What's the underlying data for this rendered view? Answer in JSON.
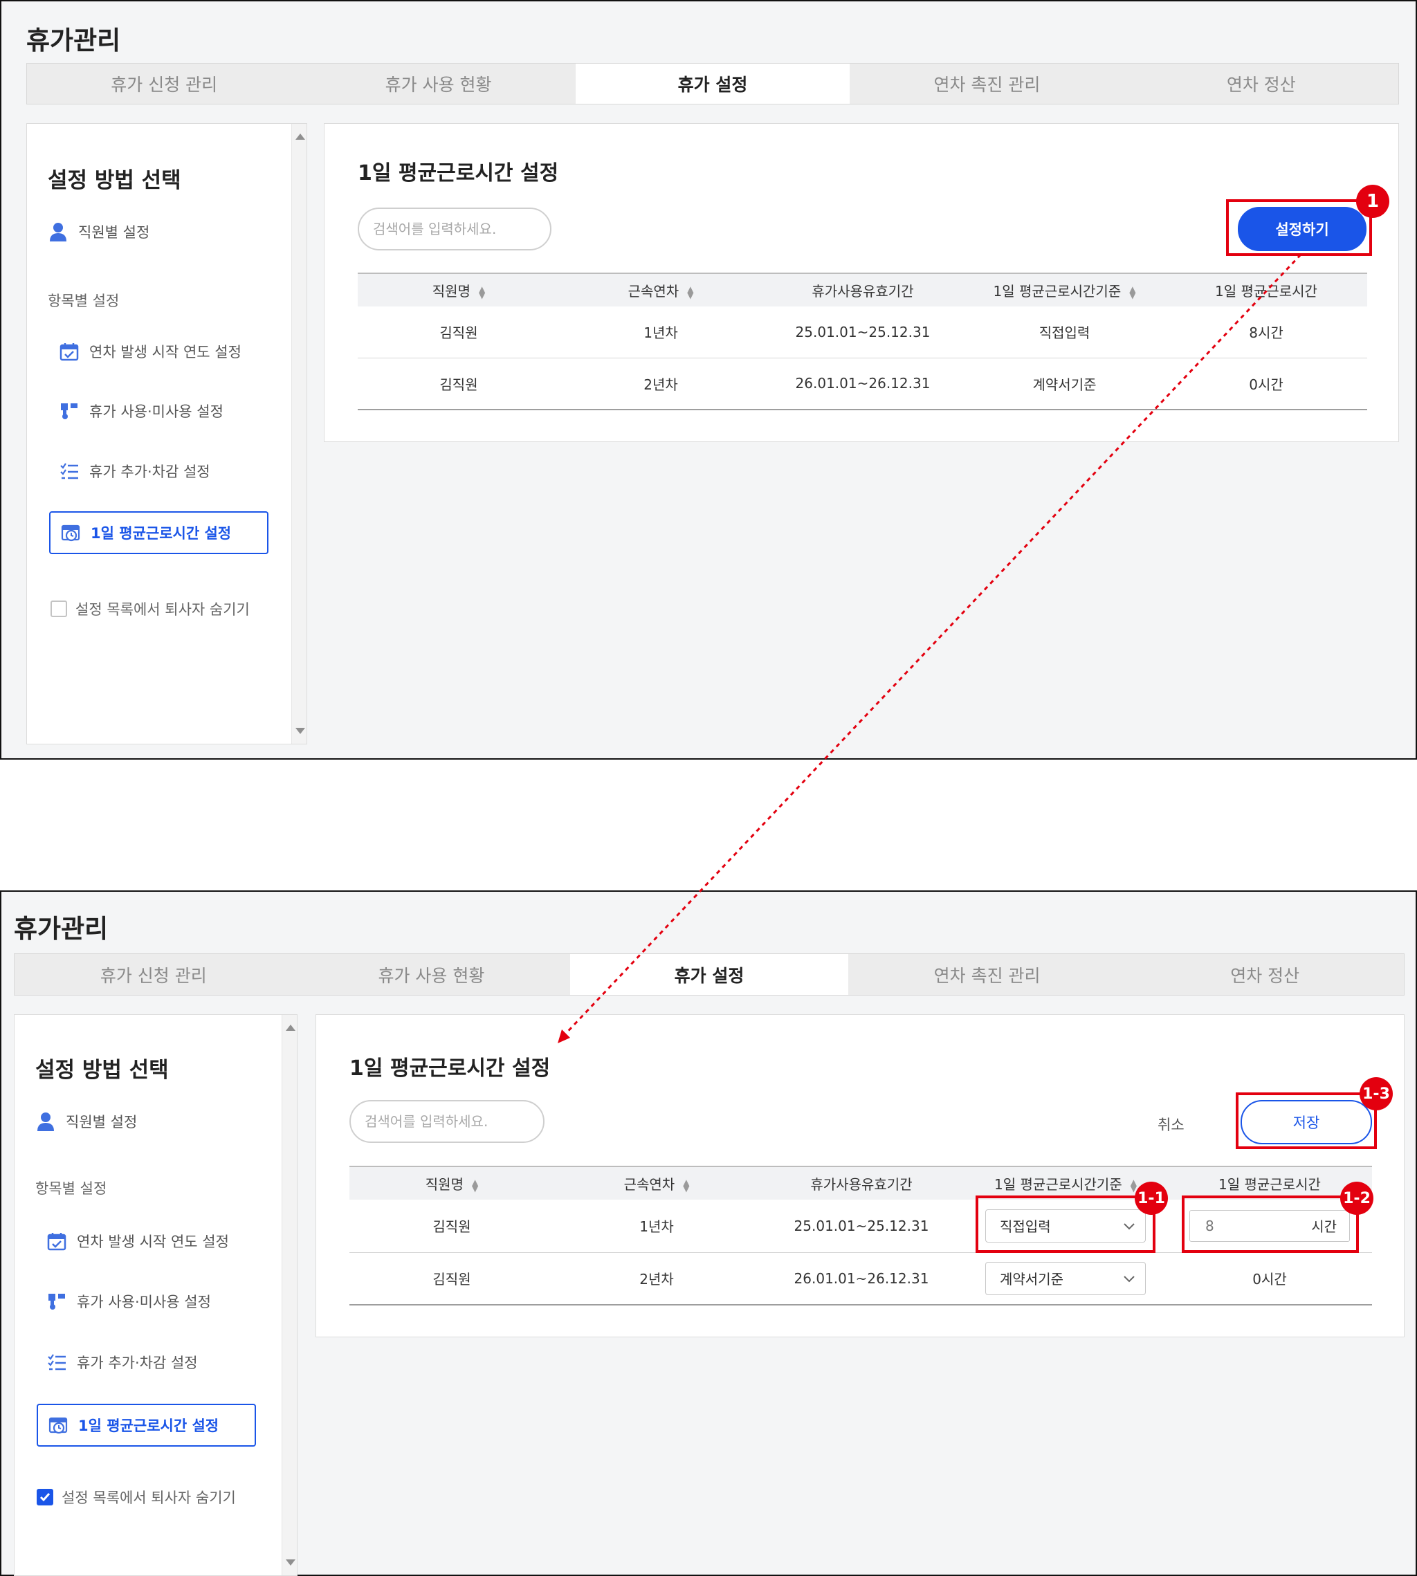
{
  "app_title": "휴가관리",
  "tabs": [
    "휴가 신청 관리",
    "휴가 사용 현황",
    "휴가 설정",
    "연차 촉진 관리",
    "연차 정산"
  ],
  "active_tab": "휴가 설정",
  "sidebar": {
    "heading": "설정 방법 선택",
    "by_employee": "직원별 설정",
    "section_label": "항목별 설정",
    "items": [
      "연차 발생 시작 연도 설정",
      "휴가 사용·미사용 설정",
      "휴가 추가·차감 설정"
    ],
    "active_item": "1일 평균근로시간 설정",
    "hide_retired_label": "설정 목록에서 퇴사자 숨기기",
    "hide_retired_checked_top": false,
    "hide_retired_checked_bottom": true
  },
  "content": {
    "title": "1일 평균근로시간 설정",
    "search_placeholder": "검색어를 입력하세요.",
    "setup_button": "설정하기",
    "cancel_label": "취소",
    "save_button": "저장"
  },
  "table": {
    "headers": [
      "직원명",
      "근속연차",
      "휴가사용유효기간",
      "1일 평균근로시간기준",
      "1일 평균근로시간"
    ],
    "sortable": [
      true,
      true,
      false,
      true,
      false
    ],
    "rows": [
      {
        "name": "김직원",
        "year": "1년차",
        "period": "25.01.01~25.12.31",
        "basis": "직접입력",
        "hours": "8시간"
      },
      {
        "name": "김직원",
        "year": "2년차",
        "period": "26.01.01~26.12.31",
        "basis": "계약서기준",
        "hours": "0시간"
      }
    ]
  },
  "edit": {
    "hours_value": "8",
    "hours_unit": "시간"
  },
  "badges": [
    "1",
    "1-1",
    "1-2",
    "1-3"
  ],
  "colors": {
    "accent": "#1a55e8",
    "highlight": "#e3000f",
    "panel_bg": "#f4f5f6"
  }
}
